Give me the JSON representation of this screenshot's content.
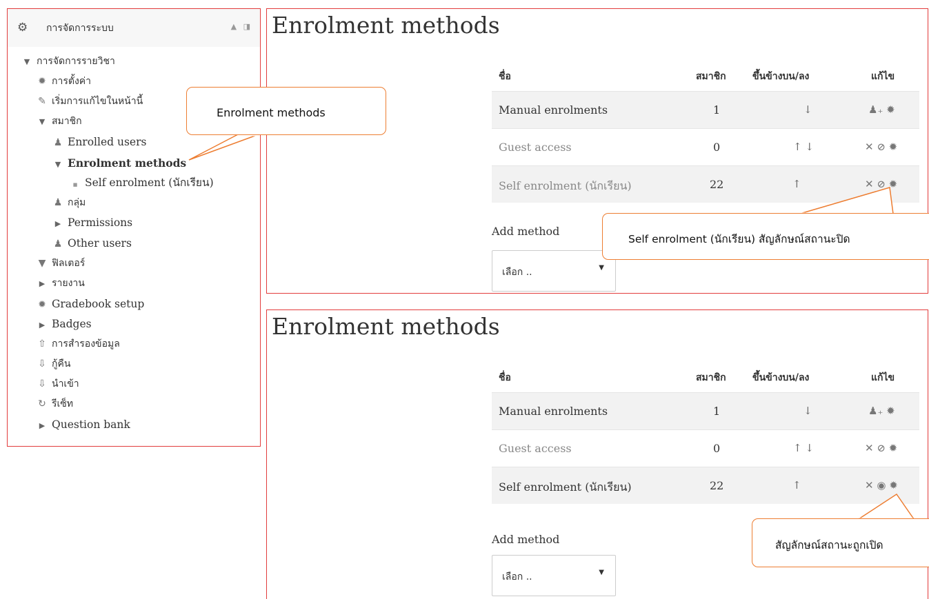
{
  "sidebar": {
    "title": "การจัดการระบบ",
    "collapse_icon": "▲",
    "dock_icon": "◨",
    "items": [
      {
        "label": "การจัดการรายวิชา",
        "icon": "▼"
      },
      {
        "label": "การตั้งค่า",
        "icon": "✹"
      },
      {
        "label": "เริ่มการแก้ไขในหน้านี้",
        "icon": "✎"
      },
      {
        "label": "สมาชิก",
        "icon": "▼"
      },
      {
        "label": "Enrolled users",
        "icon": "♟"
      },
      {
        "label": "Enrolment methods",
        "icon": "▼"
      },
      {
        "label": "Self enrolment (นักเรียน)",
        "icon": "■"
      },
      {
        "label": "กลุ่ม",
        "icon": "♟"
      },
      {
        "label": "Permissions",
        "icon": "▶"
      },
      {
        "label": "Other users",
        "icon": "♟"
      },
      {
        "label": "ฟิลเตอร์",
        "icon": "▼"
      },
      {
        "label": "รายงาน",
        "icon": "▶"
      },
      {
        "label": "Gradebook setup",
        "icon": "✹"
      },
      {
        "label": "Badges",
        "icon": "▶"
      },
      {
        "label": "การสำรองข้อมูล",
        "icon": "⇧"
      },
      {
        "label": "กู้คืน",
        "icon": "⇩"
      },
      {
        "label": "นำเข้า",
        "icon": "⇩"
      },
      {
        "label": "รีเซ็ท",
        "icon": "↻"
      },
      {
        "label": "Question bank",
        "icon": "▶"
      }
    ]
  },
  "panels": [
    {
      "title": "Enrolment methods",
      "headers": [
        "ชื่อ",
        "สมาชิก",
        "ขึ้นข้างบน/ลง",
        "แก้ไข"
      ],
      "rows": [
        {
          "name": "Manual enrolments",
          "users": "1",
          "updown": "↓",
          "edit": "♟₊ ✹"
        },
        {
          "name": "Guest access",
          "users": "0",
          "updown": "↑ ↓",
          "edit": "✕ ⊘ ✹"
        },
        {
          "name": "Self enrolment (นักเรียน)",
          "users": "22",
          "updown": "↑",
          "edit": "✕ ⊘ ✹"
        }
      ],
      "add_method_label": "Add method",
      "select_value": "เลือก ..",
      "select_caret": "▼"
    },
    {
      "title": "Enrolment methods",
      "headers": [
        "ชื่อ",
        "สมาชิก",
        "ขึ้นข้างบน/ลง",
        "แก้ไข"
      ],
      "rows": [
        {
          "name": "Manual enrolments",
          "users": "1",
          "updown": "↓",
          "edit": "♟₊ ✹"
        },
        {
          "name": "Guest access",
          "users": "0",
          "updown": "↑ ↓",
          "edit": "✕ ⊘ ✹"
        },
        {
          "name": "Self enrolment (นักเรียน)",
          "users": "22",
          "updown": "↑",
          "edit": "✕ ◉ ✹"
        }
      ],
      "add_method_label": "Add method",
      "select_value": "เลือก ..",
      "select_caret": "▼"
    }
  ],
  "callouts": {
    "enrolment_methods": "Enrolment methods",
    "self_enrol_closed": "Self enrolment (นักเรียน) สัญลักษณ์สถานะปิด",
    "status_opened": "สัญลักษณ์สถานะถูกเปิด"
  },
  "colors": {
    "annotation_border": "#e23b3b",
    "callout_border": "#ed7d31",
    "row_stripe": "#f2f2f2"
  }
}
